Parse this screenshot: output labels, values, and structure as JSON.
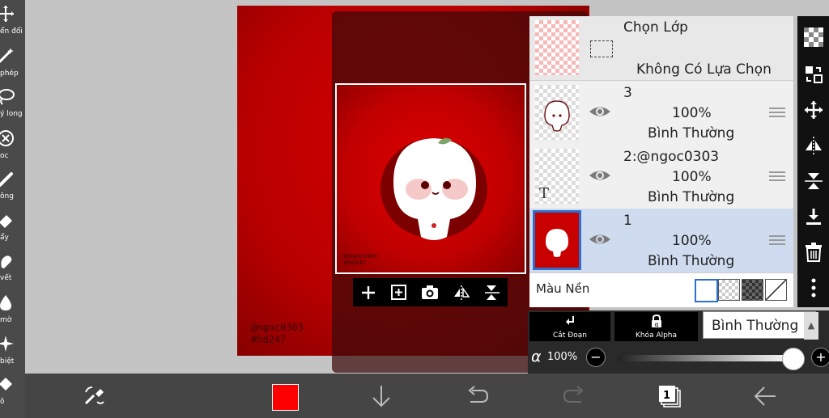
{
  "left_toolbar": {
    "tools": [
      {
        "label": "ển đổi",
        "icon": "move-arrows-icon"
      },
      {
        "label": "phép",
        "icon": "magic-wand-icon"
      },
      {
        "label": "ý long",
        "icon": "lasso-icon"
      },
      {
        "label": "oc",
        "icon": "filter-circle-icon"
      },
      {
        "label": "ông",
        "icon": "brush-icon"
      },
      {
        "label": "ẩy",
        "icon": "eraser-icon"
      },
      {
        "label": "vết",
        "icon": "smudge-icon"
      },
      {
        "label": "mờ",
        "icon": "blur-drop-icon"
      },
      {
        "label": "biệt",
        "icon": "sparkle-icon"
      },
      {
        "label": "ô",
        "icon": "bucket-icon"
      }
    ]
  },
  "artwork": {
    "signature_lines": [
      "@ngoc0303",
      "#hd247"
    ]
  },
  "preview": {
    "tools": [
      "add-layer-icon",
      "add-filled-layer-icon",
      "camera-icon",
      "flip-horizontal-icon",
      "rotate-icon"
    ]
  },
  "layers": {
    "selection": {
      "title": "Chọn Lớp",
      "status": "Không Có Lựa Chọn"
    },
    "items": [
      {
        "name": "3",
        "opacity": "100%",
        "blend": "Bình Thường"
      },
      {
        "name": "2:@ngoc0303",
        "opacity": "100%",
        "blend": "Bình Thường",
        "thumb_text": "T"
      },
      {
        "name": "1",
        "opacity": "100%",
        "blend": "Bình Thường"
      }
    ],
    "background": {
      "label": "Màu Nền"
    }
  },
  "options": {
    "clip_label": "Cắt Đoạn",
    "lock_alpha_label": "Khóa Alpha",
    "blend_mode": "Bình Thường",
    "alpha_symbol": "α",
    "alpha_value": "100%",
    "alpha_fraction": 1.0,
    "minus": "−",
    "plus": "+"
  },
  "bottom": {
    "page_count": "1",
    "color": "#ff0000"
  }
}
